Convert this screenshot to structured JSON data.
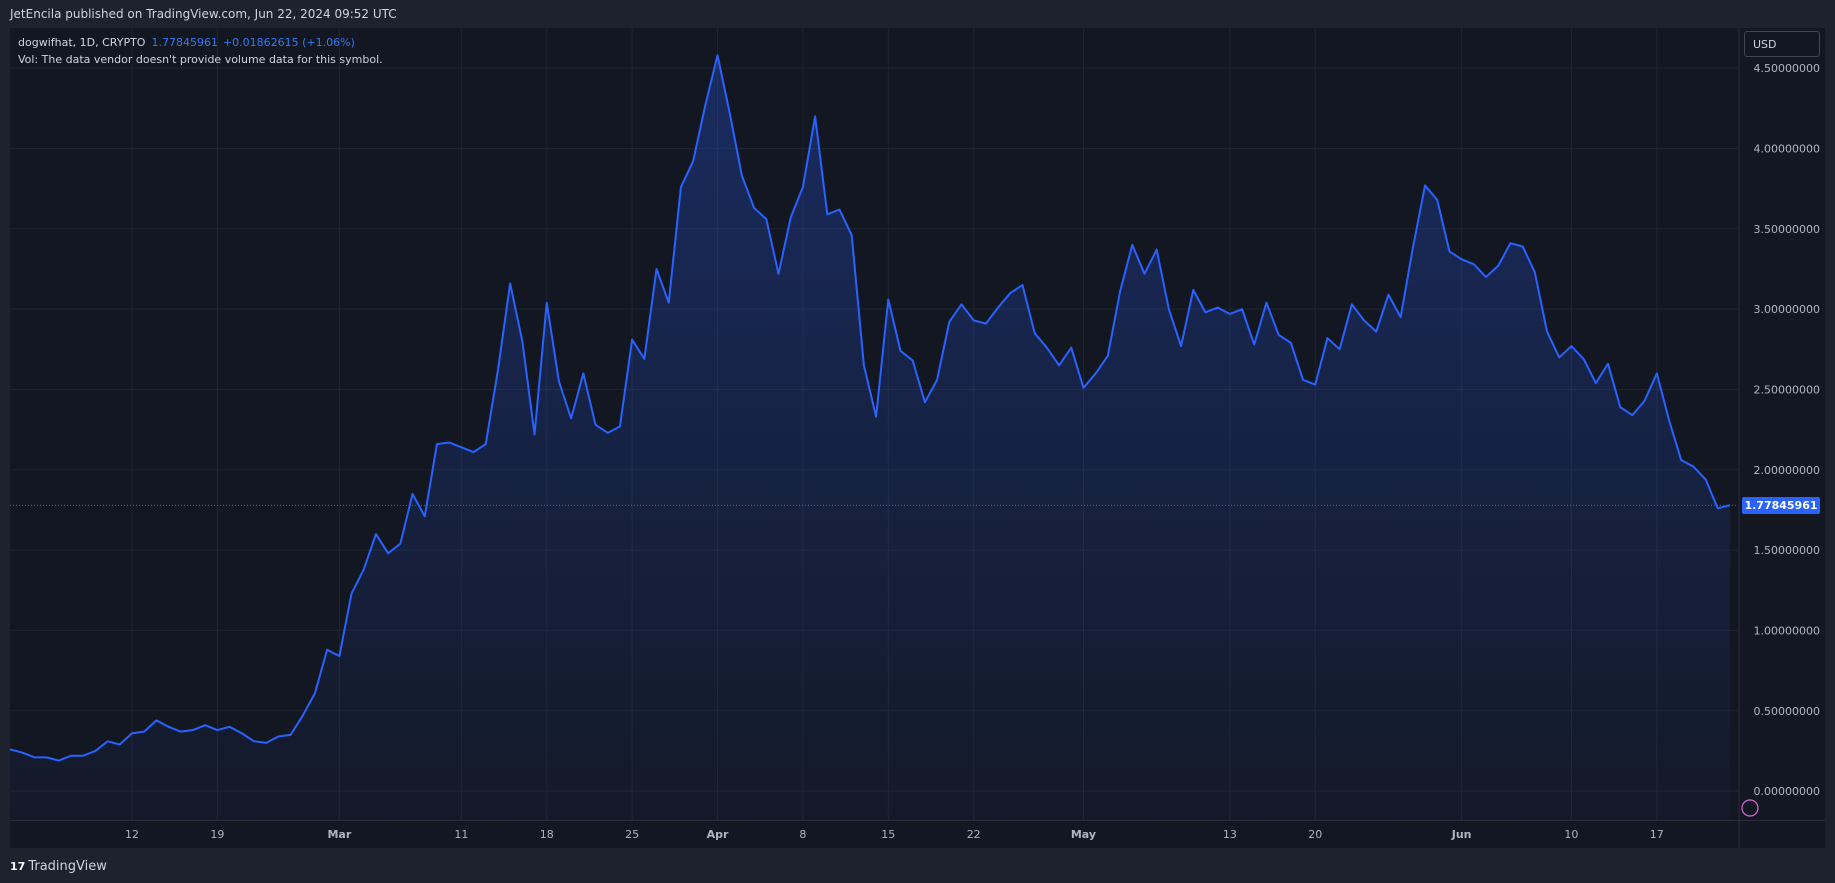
{
  "header": {
    "publish_line": "JetEncila published on TradingView.com, Jun 22, 2024 09:52 UTC"
  },
  "legend": {
    "symbol": "dogwifhat, 1D, CRYPTO",
    "last_value": "1.77845961",
    "change": "+0.01862615 (+1.06%)",
    "volume_note": "Vol: The data vendor doesn't provide volume data for this symbol."
  },
  "currency_button": "USD",
  "price_tag": "1.77845961",
  "footer": {
    "brand": "TradingView",
    "logo_mark": "17"
  },
  "colors": {
    "line": "#2962ff",
    "background": "#131722",
    "grid": "#1f2433",
    "text": "#b2b5be"
  },
  "chart_data": {
    "type": "area",
    "title": "",
    "xlabel": "",
    "ylabel": "",
    "ylim": [
      -0.18,
      4.75
    ],
    "y_ticks": [
      "0.00000000",
      "0.50000000",
      "1.00000000",
      "1.50000000",
      "2.00000000",
      "2.50000000",
      "3.00000000",
      "3.50000000",
      "4.00000000",
      "4.50000000"
    ],
    "x_tick_labels": [
      "12",
      "19",
      "Mar",
      "11",
      "18",
      "25",
      "Apr",
      "8",
      "15",
      "22",
      "May",
      "13",
      "20",
      "Jun",
      "10",
      "17"
    ],
    "x_tick_indices": [
      10,
      17,
      27,
      37,
      44,
      51,
      58,
      65,
      72,
      79,
      88,
      100,
      107,
      119,
      128,
      135
    ],
    "last_price": 1.77845961,
    "grid": true,
    "series": [
      {
        "values": [
          0.26,
          0.24,
          0.21,
          0.21,
          0.19,
          0.22,
          0.22,
          0.25,
          0.31,
          0.29,
          0.36,
          0.37,
          0.44,
          0.4,
          0.37,
          0.38,
          0.41,
          0.38,
          0.4,
          0.36,
          0.31,
          0.3,
          0.34,
          0.35,
          0.47,
          0.61,
          0.88,
          0.84,
          1.23,
          1.38,
          1.6,
          1.48,
          1.54,
          1.85,
          1.71,
          2.16,
          2.17,
          2.14,
          2.11,
          2.16,
          2.62,
          3.16,
          2.8,
          2.22,
          3.04,
          2.55,
          2.32,
          2.6,
          2.28,
          2.23,
          2.27,
          2.81,
          2.69,
          3.25,
          3.04,
          3.76,
          3.92,
          4.27,
          4.58,
          4.22,
          3.83,
          3.63,
          3.56,
          3.22,
          3.57,
          3.76,
          4.2,
          3.59,
          3.62,
          3.46,
          2.65,
          2.33,
          3.06,
          2.74,
          2.68,
          2.42,
          2.56,
          2.92,
          3.03,
          2.93,
          2.91,
          3.01,
          3.1,
          3.15,
          2.85,
          2.76,
          2.65,
          2.76,
          2.51,
          2.6,
          2.71,
          3.11,
          3.4,
          3.22,
          3.37,
          3.0,
          2.77,
          3.12,
          2.98,
          3.01,
          2.97,
          3.0,
          2.78,
          3.04,
          2.84,
          2.79,
          2.56,
          2.53,
          2.82,
          2.75,
          3.03,
          2.93,
          2.86,
          3.09,
          2.95,
          3.38,
          3.77,
          3.68,
          3.36,
          3.31,
          3.28,
          3.2,
          3.27,
          3.41,
          3.39,
          3.23,
          2.86,
          2.7,
          2.77,
          2.69,
          2.54,
          2.66,
          2.39,
          2.34,
          2.43,
          2.6,
          2.31,
          2.06,
          2.02,
          1.94,
          1.76,
          1.78
        ]
      }
    ]
  }
}
